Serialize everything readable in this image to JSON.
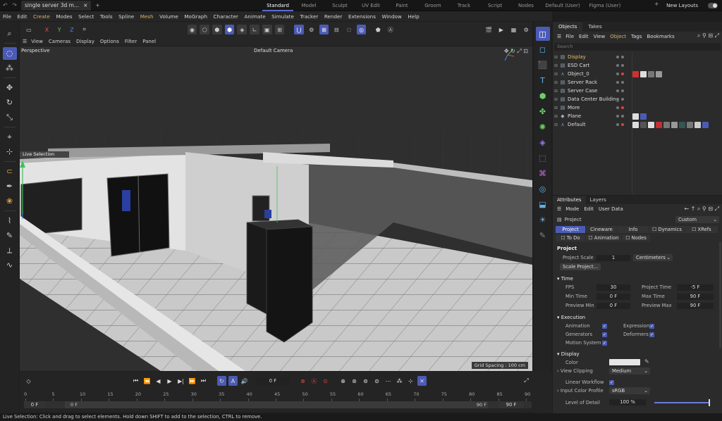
{
  "titlebar": {
    "nav": "↶ ↷",
    "doc_tab": "single server 3d m...",
    "close": "×",
    "add": "+",
    "layouts": [
      "Standard",
      "Model",
      "Sculpt",
      "UV Edit",
      "Paint",
      "Groom",
      "Track",
      "Script",
      "Nodes",
      "Default (User)",
      "Figma (User)"
    ],
    "active_layout": "Standard",
    "add_layout": "+",
    "new_layouts": "New Layouts"
  },
  "menubar": [
    "File",
    "Edit",
    "Create",
    "Modes",
    "Select",
    "Tools",
    "Spline",
    "Mesh",
    "Volume",
    "MoGraph",
    "Character",
    "Animate",
    "Simulate",
    "Tracker",
    "Render",
    "Extensions",
    "Window",
    "Help"
  ],
  "menubar_highlight": [
    "Create",
    "Mesh"
  ],
  "toolbar": {
    "x": "X",
    "y": "Y",
    "z": "Z"
  },
  "viewport": {
    "menu": [
      "View",
      "Cameras",
      "Display",
      "Options",
      "Filter",
      "Panel"
    ],
    "label": "Perspective",
    "camera": "Default Camera",
    "grid_spacing": "Grid Spacing : 100 cm",
    "live_selection": "Live Selection"
  },
  "timeline": {
    "ruler": [
      "0",
      "5",
      "10",
      "15",
      "20",
      "25",
      "30",
      "35",
      "40",
      "45",
      "50",
      "55",
      "60",
      "65",
      "70",
      "75",
      "80",
      "85",
      "90"
    ],
    "current_frame": "0 F",
    "start": "0 F",
    "min": "0 F",
    "end_a": "90 F",
    "end_b": "90 F"
  },
  "status": "Live Selection: Click and drag to select elements. Hold down SHIFT to add to the selection, CTRL to remove.",
  "objects": {
    "tabs": [
      "Objects",
      "Takes"
    ],
    "menu": [
      "File",
      "Edit",
      "View",
      "Object",
      "Tags",
      "Bookmarks"
    ],
    "menu_highlight": "Object",
    "search": "Search",
    "items": [
      {
        "name": "Display",
        "color": "#e8c060"
      },
      {
        "name": "ESD Cart",
        "color": "#dddddd"
      },
      {
        "name": "Object_0",
        "color": "#dddddd"
      },
      {
        "name": "Server Rack",
        "color": "#dddddd"
      },
      {
        "name": "Server Case",
        "color": "#dddddd"
      },
      {
        "name": "Data Center Building",
        "color": "#dddddd"
      },
      {
        "name": "More",
        "color": "#dddddd"
      },
      {
        "name": "Plane",
        "color": "#dddddd"
      },
      {
        "name": "Default",
        "color": "#dddddd"
      }
    ]
  },
  "attributes": {
    "tabs": [
      "Attributes",
      "Layers"
    ],
    "menu": [
      "Mode",
      "Edit",
      "User Data"
    ],
    "object": "Project",
    "preset": "Custom",
    "section_tabs": [
      "Project",
      "Cineware",
      "Info",
      "Dynamics",
      "XRefs"
    ],
    "section_tabs2": [
      "To Do",
      "Animation",
      "Nodes"
    ],
    "heading": "Project",
    "project_scale_label": "Project Scale",
    "project_scale": "1",
    "unit": "Centimeters",
    "scale_button": "Scale Project...",
    "time_heading": "Time",
    "fps_label": "FPS",
    "fps": "30",
    "project_time_label": "Project Time",
    "project_time": "-5 F",
    "min_time_label": "Min Time",
    "min_time": "0 F",
    "max_time_label": "Max Time",
    "max_time": "90 F",
    "preview_min_label": "Preview Min",
    "preview_min": "0 F",
    "preview_max_label": "Preview Max",
    "preview_max": "90 F",
    "execution_heading": "Execution",
    "animation_label": "Animation",
    "expression_label": "Expression",
    "generators_label": "Generators",
    "deformers_label": "Deformers",
    "motion_label": "Motion System",
    "display_heading": "Display",
    "color_label": "Color",
    "view_clipping_label": "View Clipping",
    "view_clipping": "Medium",
    "linear_label": "Linear Workflow",
    "icp_label": "Input Color Profile",
    "icp": "sRGB",
    "lod_label": "Level of Detail",
    "lod": "100 %"
  }
}
